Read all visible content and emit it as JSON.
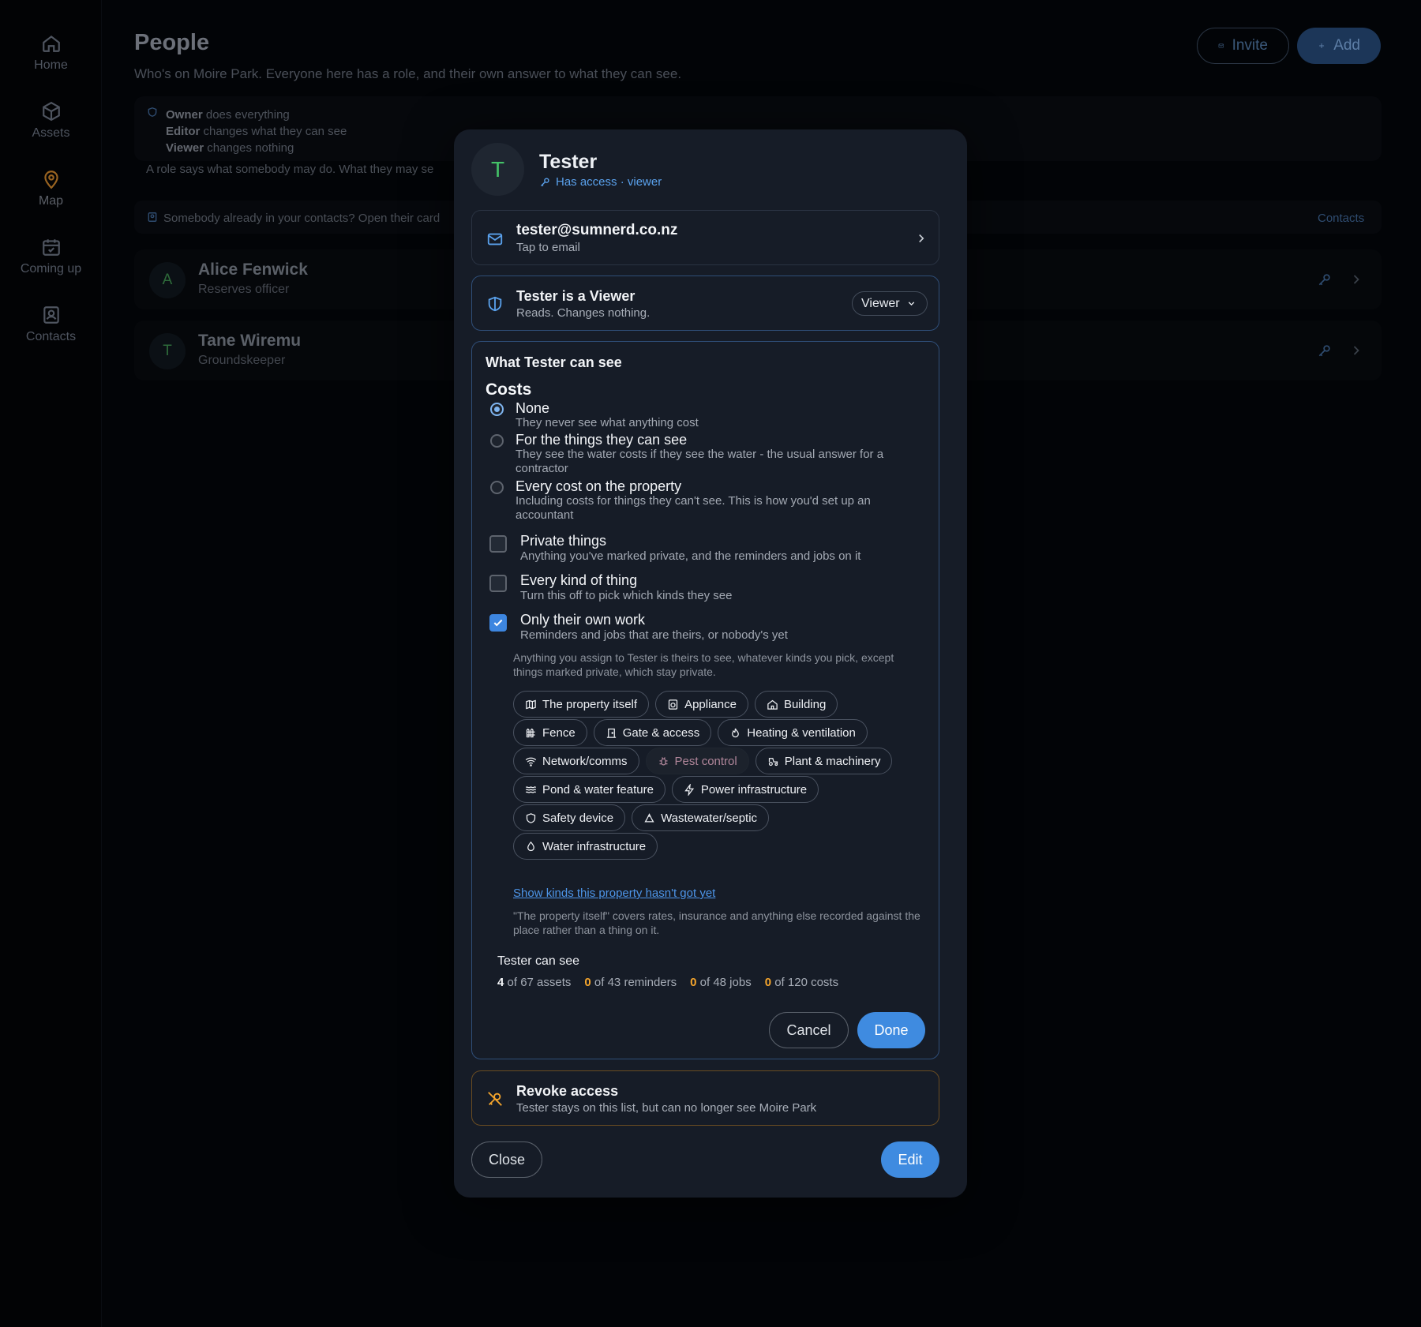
{
  "sidebar": {
    "items": [
      {
        "label": "Home",
        "icon": "home-icon"
      },
      {
        "label": "Assets",
        "icon": "cube-icon"
      },
      {
        "label": "Map",
        "icon": "map-pin-icon"
      },
      {
        "label": "Coming up",
        "icon": "calendar-check-icon"
      },
      {
        "label": "Contacts",
        "icon": "contact-book-icon"
      }
    ]
  },
  "header": {
    "title": "People",
    "subtitle": "Who's on Moire Park. Everyone here has a role, and their own answer to what they can see.",
    "invite_label": "Invite",
    "add_label": "Add"
  },
  "roles": {
    "owner_name": "Owner",
    "owner_text": " does everything",
    "editor_name": "Editor",
    "editor_text": " changes what they can see",
    "viewer_name": "Viewer",
    "viewer_text": " changes nothing",
    "footnote": "A role says what somebody may do. What they may se"
  },
  "contacts_note": {
    "text": "Somebody already in your contacts? Open their card",
    "link": "Contacts"
  },
  "people": [
    {
      "initial": "A",
      "name": "Alice Fenwick",
      "role": "Reserves officer"
    },
    {
      "initial": "T",
      "name": "Tane Wiremu",
      "role": "Groundskeeper"
    }
  ],
  "modal": {
    "initial": "T",
    "name": "Tester",
    "access": "Has access · viewer",
    "email": "tester@sumnerd.co.nz",
    "email_hint": "Tap to email",
    "role_title": "Tester is a Viewer",
    "role_sub": "Reads. Changes nothing.",
    "role_select": "Viewer",
    "see_heading": "What Tester can see",
    "costs_title": "Costs",
    "cost_options": [
      {
        "title": "None",
        "sub": "They never see what anything cost",
        "selected": true
      },
      {
        "title": "For the things they can see",
        "sub": "They see the water costs if they see the water - the usual answer for a contractor",
        "selected": false
      },
      {
        "title": "Every cost on the property",
        "sub": "Including costs for things they can't see. This is how you'd set up an accountant",
        "selected": false
      }
    ],
    "checks": [
      {
        "title": "Private things",
        "sub": "Anything you've marked private, and the reminders and jobs on it",
        "checked": false
      },
      {
        "title": "Every kind of thing",
        "sub": "Turn this off to pick which kinds they see",
        "checked": false
      },
      {
        "title": "Only their own work",
        "sub": "Reminders and jobs that are theirs, or nobody's yet",
        "checked": true
      }
    ],
    "assign_note": "Anything you assign to Tester is theirs to see, whatever kinds you pick, except things marked private, which stay private.",
    "chips": [
      [
        "The property itself",
        "Appliance",
        "Building"
      ],
      [
        "Fence",
        "Gate & access",
        "Heating & ventilation"
      ],
      [
        "Network/comms",
        "Pest control",
        "Plant & machinery"
      ],
      [
        "Pond & water feature",
        "Power infrastructure"
      ],
      [
        "Safety device",
        "Wastewater/septic"
      ],
      [
        "Water infrastructure"
      ]
    ],
    "show_link": "Show kinds this property hasn't got yet",
    "prop_note": "\"The property itself\" covers rates, insurance and anything else recorded against the place rather than a thing on it.",
    "can_see_title": "Tester can see",
    "stats": [
      {
        "n": "4",
        "text": " of 67 assets"
      },
      {
        "n": "0",
        "text": " of 43 reminders"
      },
      {
        "n": "0",
        "text": " of 48 jobs"
      },
      {
        "n": "0",
        "text": " of 120 costs"
      }
    ],
    "cancel_label": "Cancel",
    "done_label": "Done",
    "revoke_title": "Revoke access",
    "revoke_sub": "Tester stays on this list, but can no longer see Moire Park",
    "close_label": "Close",
    "edit_label": "Edit"
  },
  "colors": {
    "accent": "#3f8be0",
    "avatar_green": "#44c268",
    "warning_orange": "#f5a52c"
  }
}
